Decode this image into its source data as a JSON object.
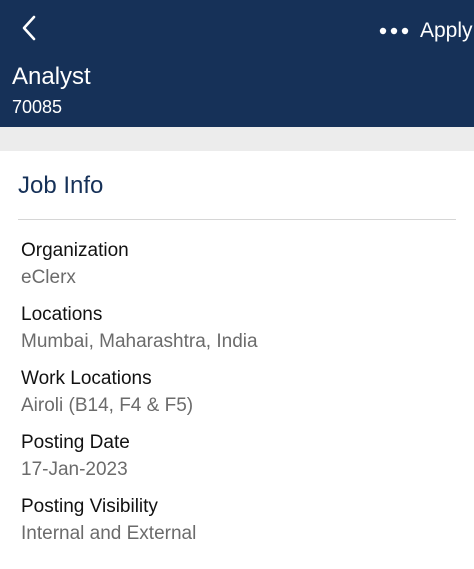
{
  "header": {
    "back_icon": "chevron-left-icon",
    "more_icon": "more-horizontal-icon",
    "apply_label": "Apply",
    "title": "Analyst",
    "job_id": "70085",
    "background_color": "#163158"
  },
  "job_info": {
    "section_title": "Job Info",
    "fields": [
      {
        "label": "Organization",
        "value": "eClerx"
      },
      {
        "label": "Locations",
        "value": "Mumbai, Maharashtra, India"
      },
      {
        "label": "Work Locations",
        "value": "Airoli (B14, F4 & F5)"
      },
      {
        "label": "Posting Date",
        "value": "17-Jan-2023"
      },
      {
        "label": "Posting Visibility",
        "value": "Internal and External"
      }
    ]
  }
}
